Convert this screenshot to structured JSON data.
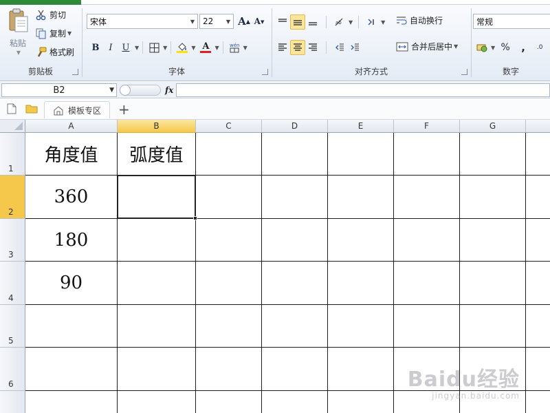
{
  "ribbon": {
    "clipboard": {
      "paste_label": "粘贴",
      "cut_label": "剪切",
      "copy_label": "复制",
      "format_painter_label": "格式刷",
      "group_label": "剪贴板"
    },
    "font": {
      "font_name": "宋体",
      "font_size": "22",
      "group_label": "字体"
    },
    "alignment": {
      "wrap_text_label": "自动换行",
      "merge_center_label": "合并后居中",
      "group_label": "对齐方式"
    },
    "number": {
      "format_value": "常规",
      "percent_symbol": "%",
      "comma_symbol": ",",
      "group_label": "数字"
    }
  },
  "formula_bar": {
    "name_box": "B2",
    "fx_label": "fx",
    "formula_value": ""
  },
  "tab_bar": {
    "template_tab_label": "模板专区",
    "add_symbol": "+"
  },
  "sheet": {
    "columns": [
      "A",
      "B",
      "C",
      "D",
      "E",
      "F",
      "G"
    ],
    "selected_column": "B",
    "rows": [
      "1",
      "2",
      "3",
      "4",
      "5",
      "6"
    ],
    "selected_row": "2",
    "active_cell": "B2",
    "cells": {
      "A1": "角度值",
      "B1": "弧度值",
      "A2": "360",
      "A3": "180",
      "A4": "90"
    }
  },
  "watermark": {
    "logo_text": "Baidu经验",
    "url_text": "jingyan.baidu.com"
  },
  "colors": {
    "accent_active": "#fbe49b",
    "selected_header": "#f5c84b",
    "file_tab": "#2f8a3a",
    "font_color_bar": "#e02020",
    "highlight_bar": "#ffe000"
  },
  "icons": [
    "paste-icon",
    "cut-icon",
    "copy-icon",
    "format-painter-icon",
    "grow-font-icon",
    "shrink-font-icon",
    "bold-icon",
    "italic-icon",
    "underline-icon",
    "border-icon",
    "fill-color-icon",
    "font-color-icon",
    "phonetic-icon",
    "align-top-icon",
    "align-middle-icon",
    "align-bottom-icon",
    "orientation-icon",
    "indent-icon",
    "align-left-icon",
    "align-center-icon",
    "align-right-icon",
    "decrease-indent-icon",
    "increase-indent-icon",
    "wrap-text-icon",
    "merge-center-icon",
    "currency-icon",
    "percent-icon",
    "comma-icon",
    "new-file-icon",
    "folder-icon",
    "home-icon",
    "fx-icon"
  ]
}
